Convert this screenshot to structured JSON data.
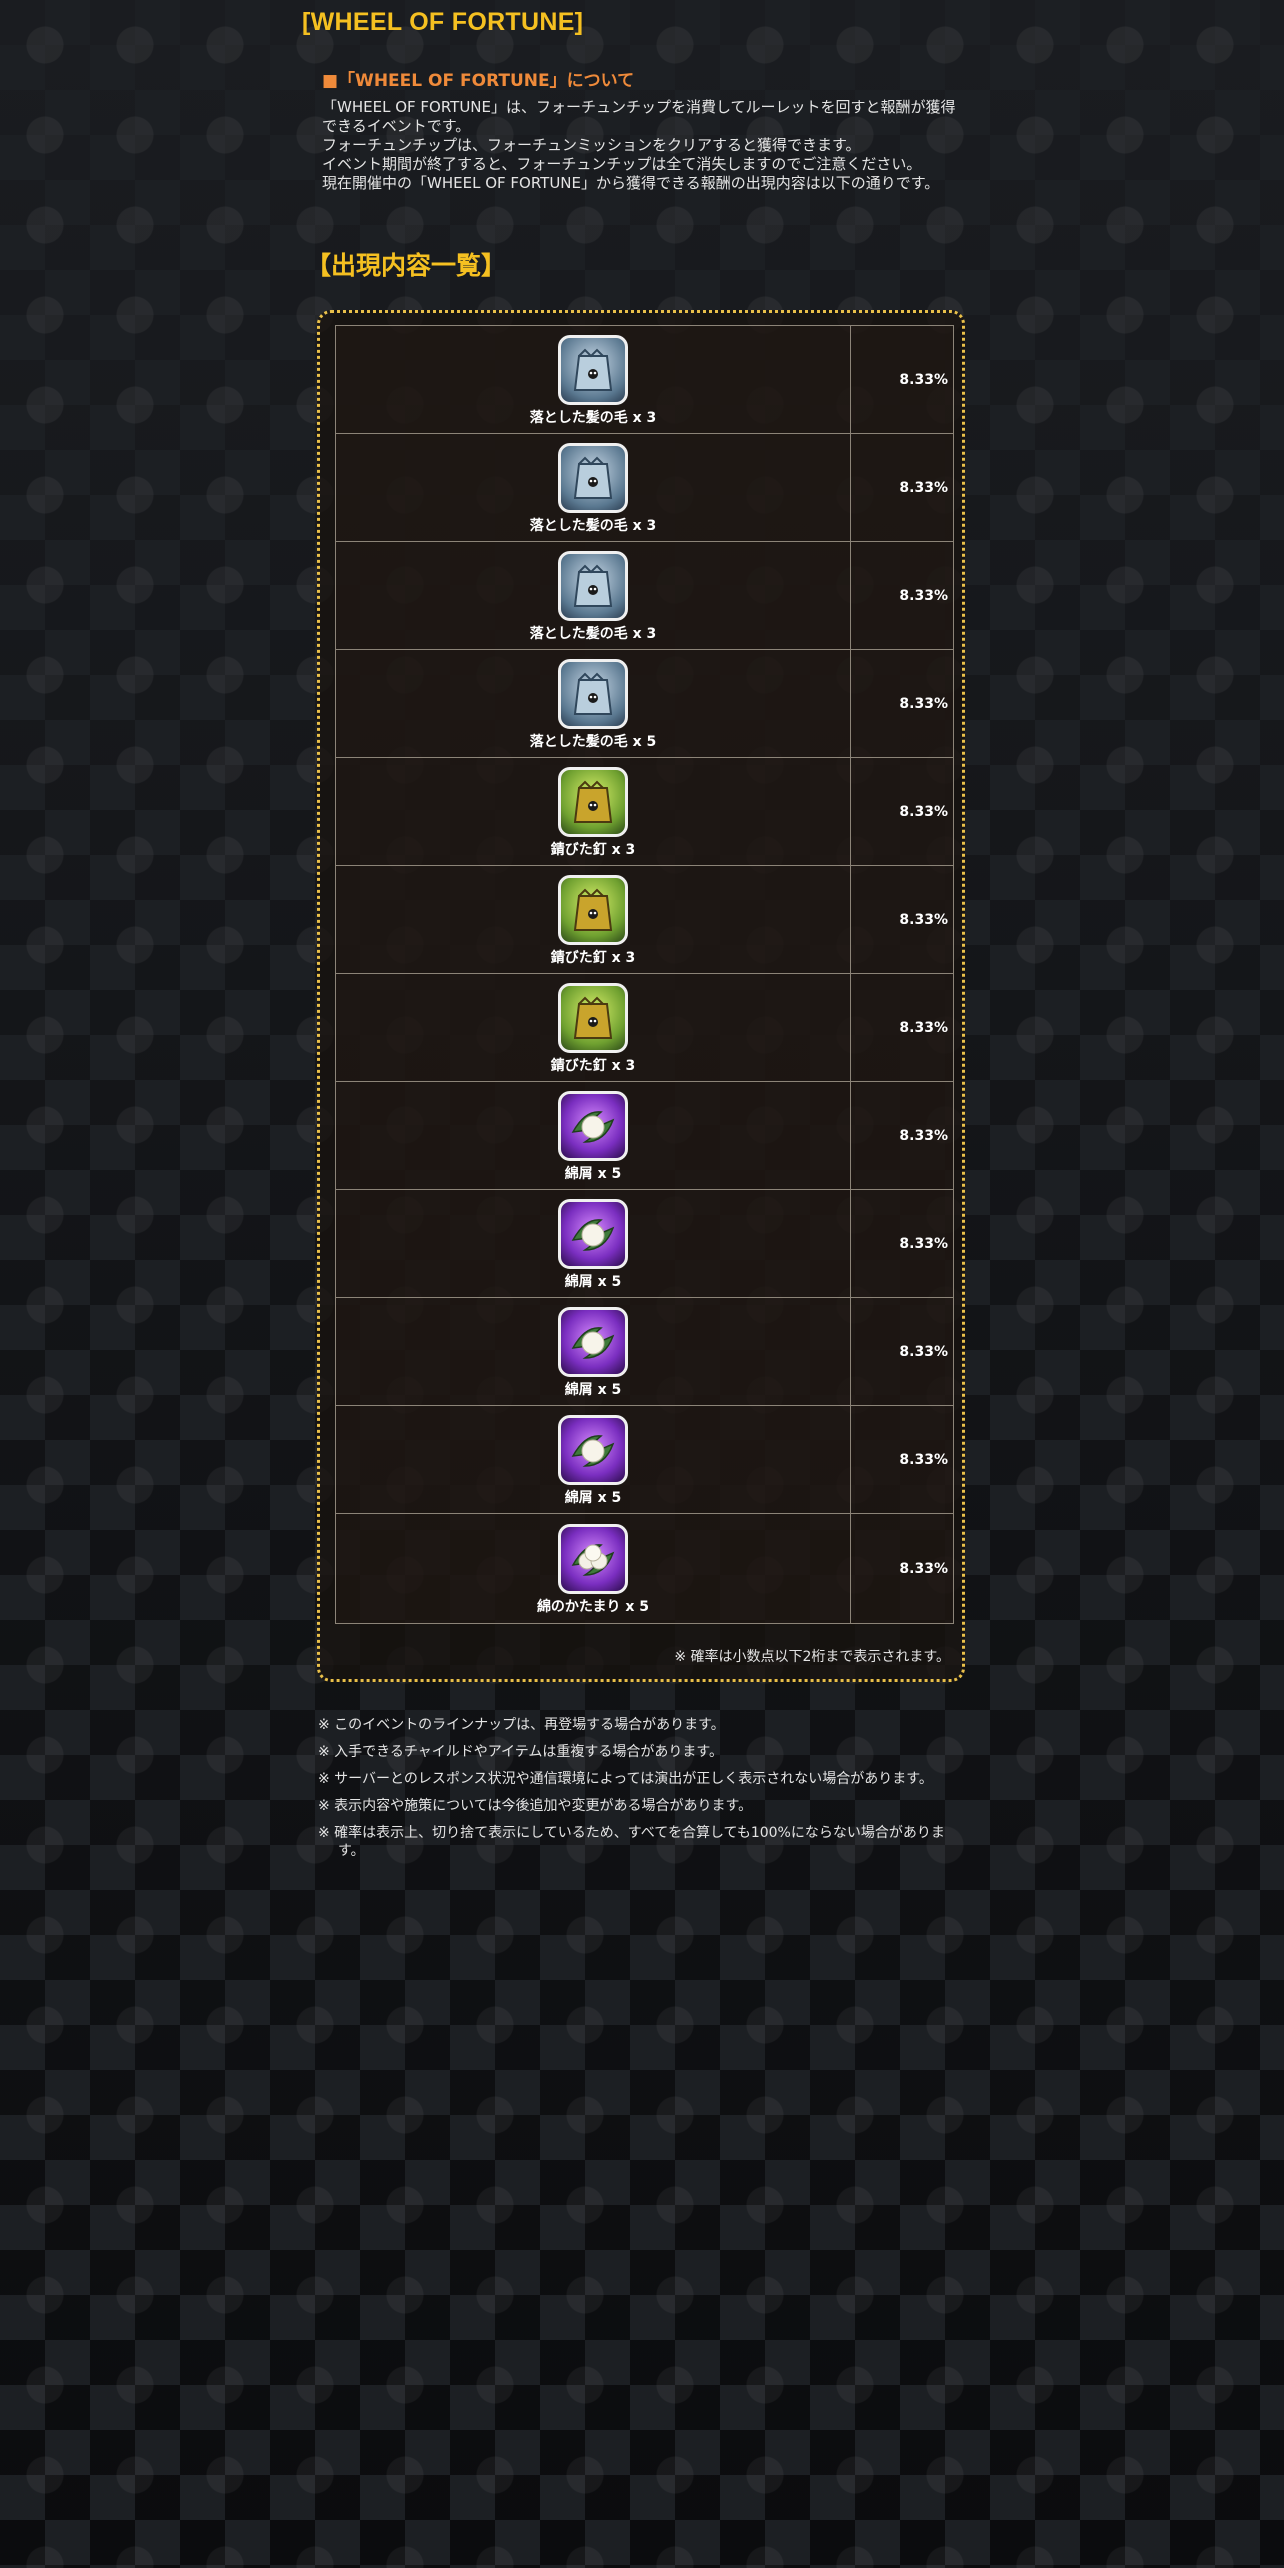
{
  "page": {
    "title": "[WHEEL OF FORTUNE]",
    "about_heading": "■「WHEEL OF FORTUNE」について",
    "about_lines": [
      "「WHEEL OF FORTUNE」は、フォーチュンチップを消費してルーレットを回すと報酬が獲得できるイベントです。",
      "フォーチュンチップは、フォーチュンミッションをクリアすると獲得できます。",
      "イベント期間が終了すると、フォーチュンチップは全て消失しますのでご注意ください。",
      "現在開催中の「WHEEL OF FORTUNE」から獲得できる報酬の出現内容は以下の通りです。"
    ],
    "lineup_heading": "【出現内容一覧】"
  },
  "lineup": [
    {
      "name": "落とした髪の毛 x 3",
      "rate": "8.33%",
      "icon": "hair-bag-icon"
    },
    {
      "name": "落とした髪の毛 x 3",
      "rate": "8.33%",
      "icon": "hair-bag-icon"
    },
    {
      "name": "落とした髪の毛 x 3",
      "rate": "8.33%",
      "icon": "hair-bag-icon"
    },
    {
      "name": "落とした髪の毛 x 5",
      "rate": "8.33%",
      "icon": "hair-bag-icon"
    },
    {
      "name": "錆びた釘 x 3",
      "rate": "8.33%",
      "icon": "rusty-nail-bag-icon"
    },
    {
      "name": "錆びた釘 x 3",
      "rate": "8.33%",
      "icon": "rusty-nail-bag-icon"
    },
    {
      "name": "錆びた釘 x 3",
      "rate": "8.33%",
      "icon": "rusty-nail-bag-icon"
    },
    {
      "name": "綿屑 x 5",
      "rate": "8.33%",
      "icon": "cotton-lint-icon"
    },
    {
      "name": "綿屑 x 5",
      "rate": "8.33%",
      "icon": "cotton-lint-icon"
    },
    {
      "name": "綿屑 x 5",
      "rate": "8.33%",
      "icon": "cotton-lint-icon"
    },
    {
      "name": "綿屑 x 5",
      "rate": "8.33%",
      "icon": "cotton-lint-icon"
    },
    {
      "name": "綿のかたまり x 5",
      "rate": "8.33%",
      "icon": "cotton-clump-icon"
    }
  ],
  "rate_note": "※ 確率は小数点以下2桁まで表示されます。",
  "notes": [
    "※ このイベントのラインナップは、再登場する場合があります。",
    "※ 入手できるチャイルドやアイテムは重複する場合があります。",
    "※ サーバーとのレスポンス状況や通信環境によっては演出が正しく表示されない場合があります。",
    "※ 表示内容や施策については今後追加や変更がある場合があります。",
    "※ 確率は表示上、切り捨て表示にしているため、すべてを合算しても100%にならない場合があります。"
  ],
  "colors": {
    "title": "#f5c021",
    "about_heading": "#ef8a3a",
    "panel_border": "#e9c04a"
  }
}
